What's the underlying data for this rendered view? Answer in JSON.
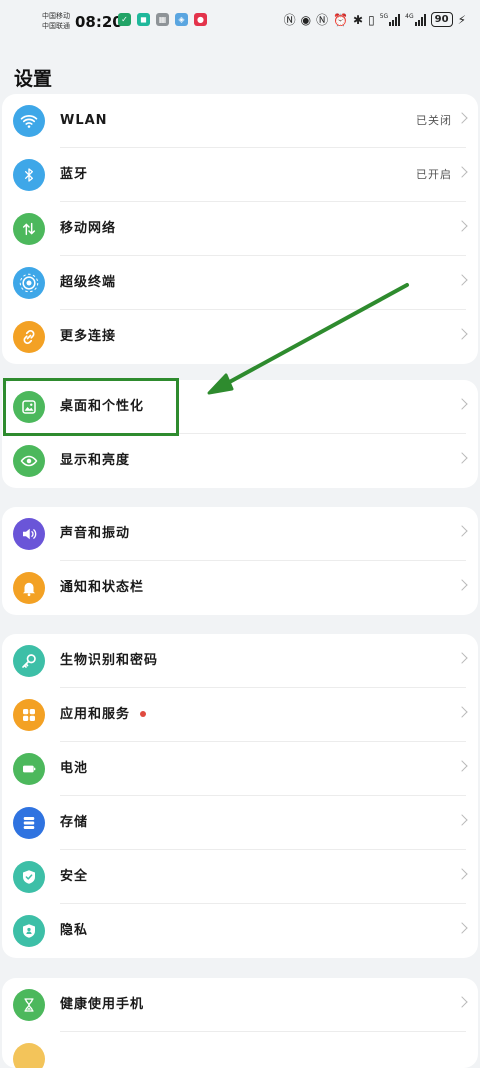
{
  "status_bar": {
    "carrier_1": "中国移动",
    "carrier_2": "中国联通",
    "time": "08:20",
    "net_5g": "5G",
    "net_4g": "4G",
    "battery": "90",
    "apps": [
      {
        "icon": "app-badge-green-icon",
        "color": "#21a366",
        "glyph": "✓"
      },
      {
        "icon": "app-badge-teal-icon",
        "color": "#1fb89b",
        "glyph": "◼"
      },
      {
        "icon": "app-badge-gray-icon",
        "color": "#8e9397",
        "glyph": "▦"
      },
      {
        "icon": "app-badge-blue-icon",
        "color": "#5aa5e0",
        "glyph": "◈"
      },
      {
        "icon": "app-badge-red-icon",
        "color": "#e3334b",
        "glyph": "●"
      }
    ]
  },
  "page": {
    "title": "设置"
  },
  "groups": [
    {
      "items": [
        {
          "id": "wlan",
          "label": "WLAN",
          "status": "已关闭",
          "icon": "wifi-icon",
          "color": "#3ea7e8"
        },
        {
          "id": "bluetooth",
          "label": "蓝牙",
          "status": "已开启",
          "icon": "bluetooth-icon",
          "color": "#3ea7e8"
        },
        {
          "id": "mobile-network",
          "label": "移动网络",
          "icon": "mobile-data-icon",
          "color": "#4cb85c"
        },
        {
          "id": "super-terminal",
          "label": "超级终端",
          "icon": "super-terminal-icon",
          "color": "#3ea7e8"
        },
        {
          "id": "more-connections",
          "label": "更多连接",
          "icon": "link-icon",
          "color": "#f3a124"
        }
      ]
    },
    {
      "items": [
        {
          "id": "home-screen",
          "label": "桌面和个性化",
          "icon": "wallpaper-icon",
          "color": "#4cb85c"
        },
        {
          "id": "display",
          "label": "显示和亮度",
          "icon": "eye-icon",
          "color": "#4cb85c"
        }
      ]
    },
    {
      "items": [
        {
          "id": "sound",
          "label": "声音和振动",
          "icon": "speaker-icon",
          "color": "#6a55d8"
        },
        {
          "id": "notifications",
          "label": "通知和状态栏",
          "icon": "bell-icon",
          "color": "#f3a124"
        }
      ]
    },
    {
      "items": [
        {
          "id": "biometrics",
          "label": "生物识别和密码",
          "icon": "key-icon",
          "color": "#3dbfa7"
        },
        {
          "id": "apps",
          "label": "应用和服务",
          "icon": "apps-grid-icon",
          "color": "#f3a124",
          "badge": true
        },
        {
          "id": "battery",
          "label": "电池",
          "icon": "battery-icon",
          "color": "#4cb85c"
        },
        {
          "id": "storage",
          "label": "存储",
          "icon": "storage-icon",
          "color": "#2f73e0"
        },
        {
          "id": "security",
          "label": "安全",
          "icon": "shield-check-icon",
          "color": "#3dbfa7"
        },
        {
          "id": "privacy",
          "label": "隐私",
          "icon": "privacy-shield-icon",
          "color": "#3dbfa7"
        }
      ]
    },
    {
      "items": [
        {
          "id": "digital-balance",
          "label": "健康使用手机",
          "icon": "hourglass-icon",
          "color": "#4cb85c"
        }
      ]
    }
  ],
  "annotation": {
    "color": "#2e8b2e",
    "target": "home-screen"
  }
}
